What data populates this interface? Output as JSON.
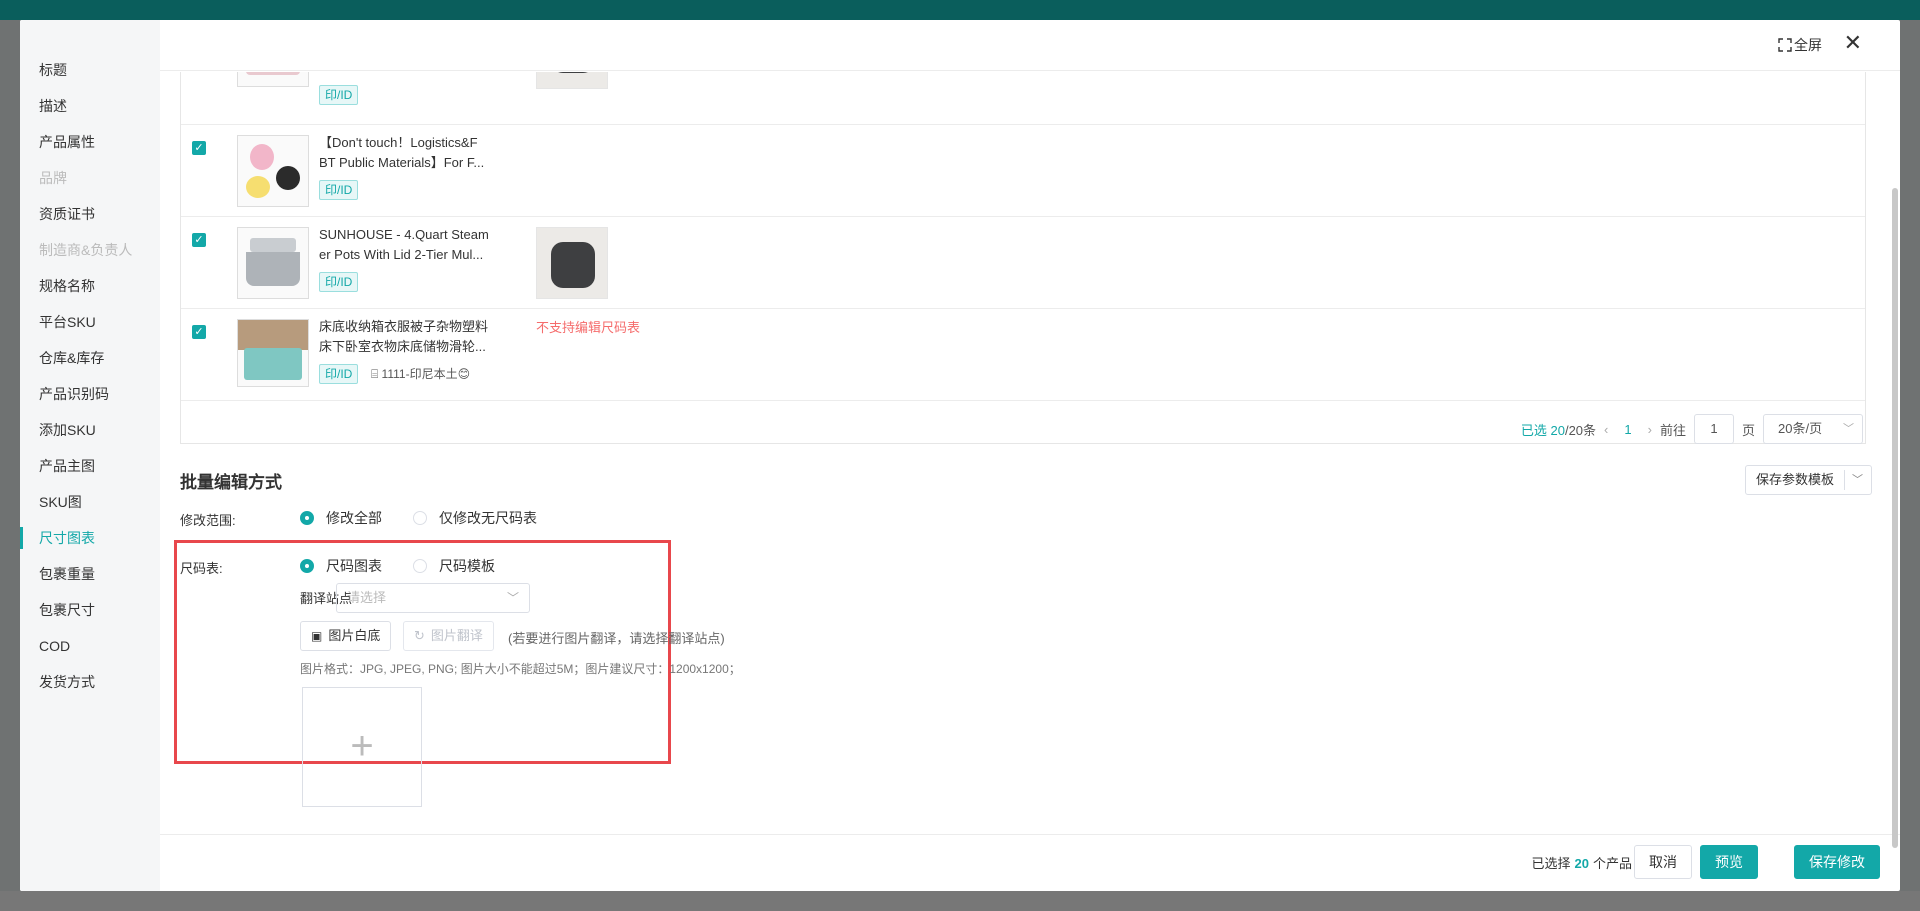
{
  "sidebar": {
    "items": [
      {
        "label": "标题",
        "state": "normal"
      },
      {
        "label": "描述",
        "state": "normal"
      },
      {
        "label": "产品属性",
        "state": "normal"
      },
      {
        "label": "品牌",
        "state": "disabled"
      },
      {
        "label": "资质证书",
        "state": "normal"
      },
      {
        "label": "制造商&负责人",
        "state": "disabled"
      },
      {
        "label": "规格名称",
        "state": "normal"
      },
      {
        "label": "平台SKU",
        "state": "normal"
      },
      {
        "label": "仓库&库存",
        "state": "normal"
      },
      {
        "label": "产品识别码",
        "state": "normal"
      },
      {
        "label": "添加SKU",
        "state": "normal"
      },
      {
        "label": "产品主图",
        "state": "normal"
      },
      {
        "label": "SKU图",
        "state": "normal"
      },
      {
        "label": "尺寸图表",
        "state": "active"
      },
      {
        "label": "包裹重量",
        "state": "normal"
      },
      {
        "label": "包裹尺寸",
        "state": "normal"
      },
      {
        "label": "COD",
        "state": "normal"
      },
      {
        "label": "发货方式",
        "state": "normal"
      }
    ]
  },
  "header": {
    "fullscreen_label": "全屏"
  },
  "products": [
    {
      "title_line1": "",
      "title_line2": "",
      "tag": "印/ID",
      "store": "",
      "has_size_image": true,
      "error": ""
    },
    {
      "title_line1": "【Don't touch！Logistics&F",
      "title_line2": "BT Public Materials】For F...",
      "tag": "印/ID",
      "store": "",
      "has_size_image": false,
      "error": ""
    },
    {
      "title_line1": "SUNHOUSE - 4.Quart Steam",
      "title_line2": "er Pots With Lid 2-Tier Mul...",
      "tag": "印/ID",
      "store": "",
      "has_size_image": true,
      "error": ""
    },
    {
      "title_line1": "床底收纳箱衣服被子杂物塑料",
      "title_line2": "床下卧室衣物床底储物滑轮...",
      "tag": "印/ID",
      "store": "1111-印尼本土😊",
      "has_size_image": false,
      "error": "不支持编辑尺码表"
    }
  ],
  "pagination": {
    "selected_prefix": "已选",
    "selected_count": "20",
    "total": "/20条",
    "current_page": "1",
    "goto_label": "前往",
    "goto_value": "1",
    "page_unit": "页",
    "page_size": "20条/页"
  },
  "batch": {
    "section_title": "批量编辑方式",
    "save_template": "保存参数模板",
    "scope_label": "修改范围:",
    "scope_options": [
      "修改全部",
      "仅修改无尺码表"
    ],
    "scope_selected": 0,
    "size_label": "尺码表:",
    "size_options": [
      "尺码图表",
      "尺码模板"
    ],
    "size_selected": 0,
    "translate_label": "翻译站点",
    "translate_placeholder": "请选择",
    "white_bg_button": "图片白底",
    "translate_button": "图片翻译",
    "translate_hint": "(若要进行图片翻译，请选择翻译站点)",
    "format_hint": "图片格式：JPG, JPEG, PNG; 图片大小不能超过5M；图片建议尺寸：1200x1200；"
  },
  "footer": {
    "selected_prefix": "已选择",
    "selected_count": "20",
    "selected_suffix": "个产品",
    "cancel": "取消",
    "preview": "预览",
    "save": "保存修改"
  },
  "colors": {
    "accent": "#13a8a8",
    "error": "#f56c6c",
    "highlight_box": "#e8474c"
  },
  "icons": [
    "fullscreen-icon",
    "close-icon",
    "check-icon",
    "store-icon",
    "image-icon",
    "refresh-icon",
    "plus-icon",
    "chevron-down-icon",
    "chevron-left-icon",
    "chevron-right-icon"
  ]
}
